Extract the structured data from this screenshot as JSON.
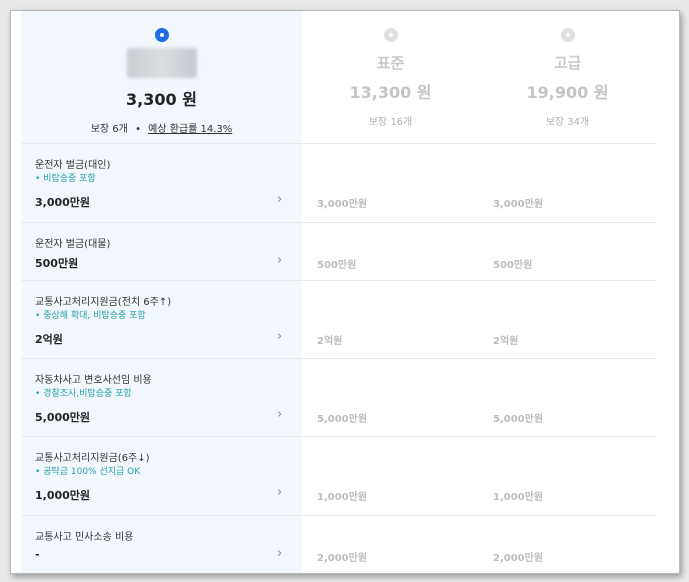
{
  "plans": [
    {
      "name": "",
      "price": "3,300 원",
      "coverage": "보장 6개",
      "refund": "예상 환급률 14.3%",
      "selected": true
    },
    {
      "name": "표준",
      "price": "13,300 원",
      "coverage": "보장 16개",
      "selected": false
    },
    {
      "name": "고급",
      "price": "19,900 원",
      "coverage": "보장 34개",
      "selected": false
    }
  ],
  "separator": "•",
  "rows": [
    {
      "title": "운전자 벌금(대인)",
      "note": "• 비탑승중 포함",
      "value": "3,000만원",
      "std": "3,000만원",
      "premium": "3,000만원"
    },
    {
      "title": "운전자 벌금(대물)",
      "note": "",
      "value": "500만원",
      "std": "500만원",
      "premium": "500만원"
    },
    {
      "title": "교통사고처리지원금(전치 6주↑)",
      "note": "• 중상해 확대, 비탑승중 포함",
      "value": "2억원",
      "std": "2억원",
      "premium": "2억원"
    },
    {
      "title": "자동차사고 변호사선임 비용",
      "note": "• 경찰조사,비탑승중 포함",
      "value": "5,000만원",
      "std": "5,000만원",
      "premium": "5,000만원"
    },
    {
      "title": "교통사고처리지원금(6주↓)",
      "note": "• 공탁금 100% 선지급 OK",
      "value": "1,000만원",
      "std": "1,000만원",
      "premium": "1,000만원"
    },
    {
      "title": "교통사고 민사소송 비용",
      "note": "",
      "value": "-",
      "std": "2,000만원",
      "premium": "2,000만원"
    }
  ],
  "colors": {
    "accent": "#1d6fe0",
    "note": "#2aa0ad",
    "selected_bg": "#f1f7fd"
  }
}
